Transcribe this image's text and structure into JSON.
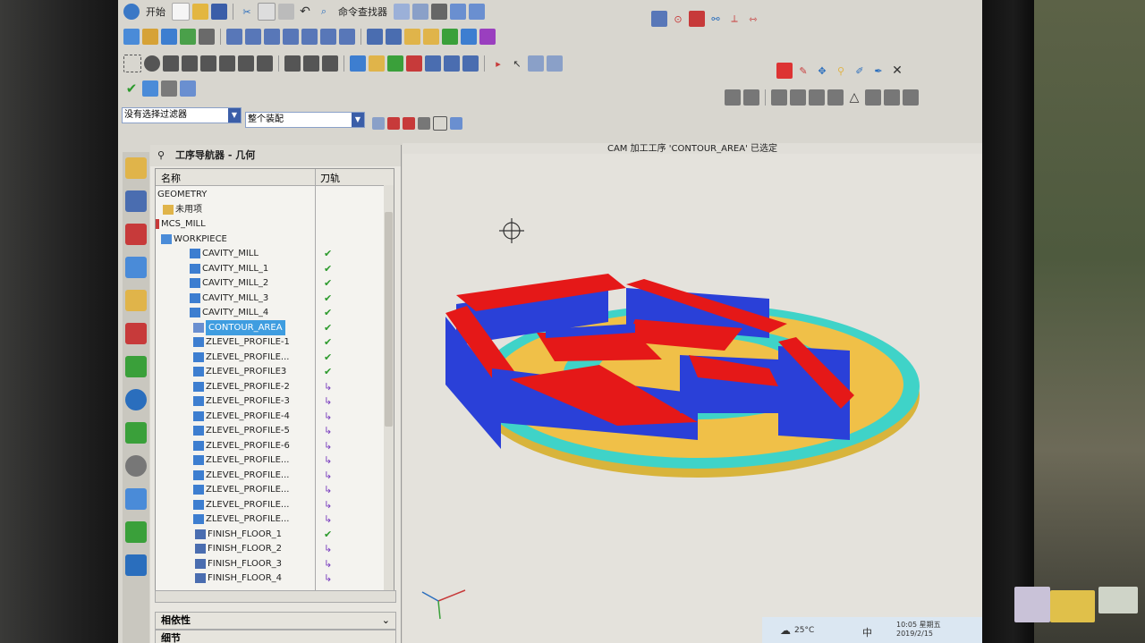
{
  "toolbar": {
    "start_label": "开始",
    "command_finder_label": "命令查找器",
    "filter_value": "没有选择过滤器",
    "assembly_value": "整个装配"
  },
  "navigator": {
    "title": "工序导航器 - 几何",
    "col_name": "名称",
    "col_path": "刀轨",
    "rows": [
      {
        "label": "GEOMETRY",
        "status": ""
      },
      {
        "label": "未用项",
        "status": ""
      },
      {
        "label": "MCS_MILL",
        "status": ""
      },
      {
        "label": "WORKPIECE",
        "status": ""
      },
      {
        "label": "CAVITY_MILL",
        "status": "✔"
      },
      {
        "label": "CAVITY_MILL_1",
        "status": "✔"
      },
      {
        "label": "CAVITY_MILL_2",
        "status": "✔"
      },
      {
        "label": "CAVITY_MILL_3",
        "status": "✔"
      },
      {
        "label": "CAVITY_MILL_4",
        "status": "✔"
      },
      {
        "label": "CONTOUR_AREA",
        "status": "✔"
      },
      {
        "label": "ZLEVEL_PROFILE-1",
        "status": "✔"
      },
      {
        "label": "ZLEVEL_PROFILE...",
        "status": "✔"
      },
      {
        "label": "ZLEVEL_PROFILE3",
        "status": "✔"
      },
      {
        "label": "ZLEVEL_PROFILE-2",
        "status": "↳"
      },
      {
        "label": "ZLEVEL_PROFILE-3",
        "status": "↳"
      },
      {
        "label": "ZLEVEL_PROFILE-4",
        "status": "↳"
      },
      {
        "label": "ZLEVEL_PROFILE-5",
        "status": "↳"
      },
      {
        "label": "ZLEVEL_PROFILE-6",
        "status": "↳"
      },
      {
        "label": "ZLEVEL_PROFILE...",
        "status": "↳"
      },
      {
        "label": "ZLEVEL_PROFILE...",
        "status": "↳"
      },
      {
        "label": "ZLEVEL_PROFILE...",
        "status": "↳"
      },
      {
        "label": "ZLEVEL_PROFILE...",
        "status": "↳"
      },
      {
        "label": "ZLEVEL_PROFILE...",
        "status": "↳"
      },
      {
        "label": "FINISH_FLOOR_1",
        "status": "✔"
      },
      {
        "label": "FINISH_FLOOR_2",
        "status": "↳"
      },
      {
        "label": "FINISH_FLOOR_3",
        "status": "↳"
      },
      {
        "label": "FINISH_FLOOR_4",
        "status": "↳"
      }
    ],
    "section_dependencies": "相依性",
    "section_details": "细节"
  },
  "viewport": {
    "title": "CAM 加工工序 'CONTOUR_AREA' 已选定"
  },
  "taskbar": {
    "time": "10:05 星期五",
    "date": "2019/2/15",
    "weather": "25°C",
    "lang": "中"
  }
}
